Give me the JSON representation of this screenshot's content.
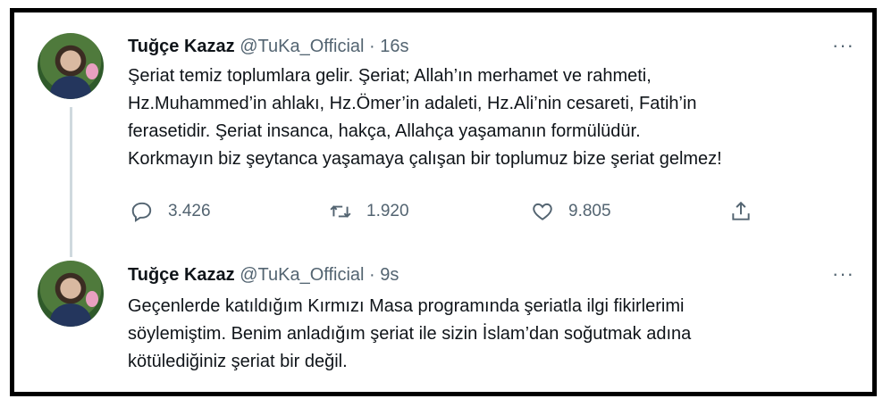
{
  "tweets": [
    {
      "display_name": "Tuğçe Kazaz",
      "handle": "@TuKa_Official",
      "separator": "·",
      "time": "16s",
      "more": "···",
      "lines": [
        "Şeriat temiz toplumlara gelir. Şeriat; Allah’ın merhamet ve rahmeti,",
        "Hz.Muhammed’in ahlakı, Hz.Ömer’in adaleti, Hz.Ali’nin cesareti, Fatih’in",
        "ferasetidir. Şeriat insanca, hakça, Allahça yaşamanın formülüdür.",
        "Korkmayın biz şeytanca yaşamaya çalışan bir toplumuz bize şeriat gelmez!"
      ],
      "replies": "3.426",
      "retweets": "1.920",
      "likes": "9.805"
    },
    {
      "display_name": "Tuğçe Kazaz",
      "handle": "@TuKa_Official",
      "separator": "·",
      "time": "9s",
      "more": "···",
      "lines": [
        "Geçenlerde katıldığım Kırmızı Masa programında şeriatla ilgi fikirlerimi",
        "söylemiştim. Benim anladığım şeriat ile sizin İslam’dan soğutmak adına",
        "kötülediğiniz şeriat bir değil."
      ]
    }
  ],
  "icons": {
    "reply": "reply-icon",
    "retweet": "retweet-icon",
    "like": "heart-icon",
    "share": "share-icon",
    "more": "more-icon"
  },
  "colors": {
    "text": "#0f1419",
    "secondary": "#536471",
    "thread_line": "#cfd9de",
    "frame": "#000000"
  }
}
